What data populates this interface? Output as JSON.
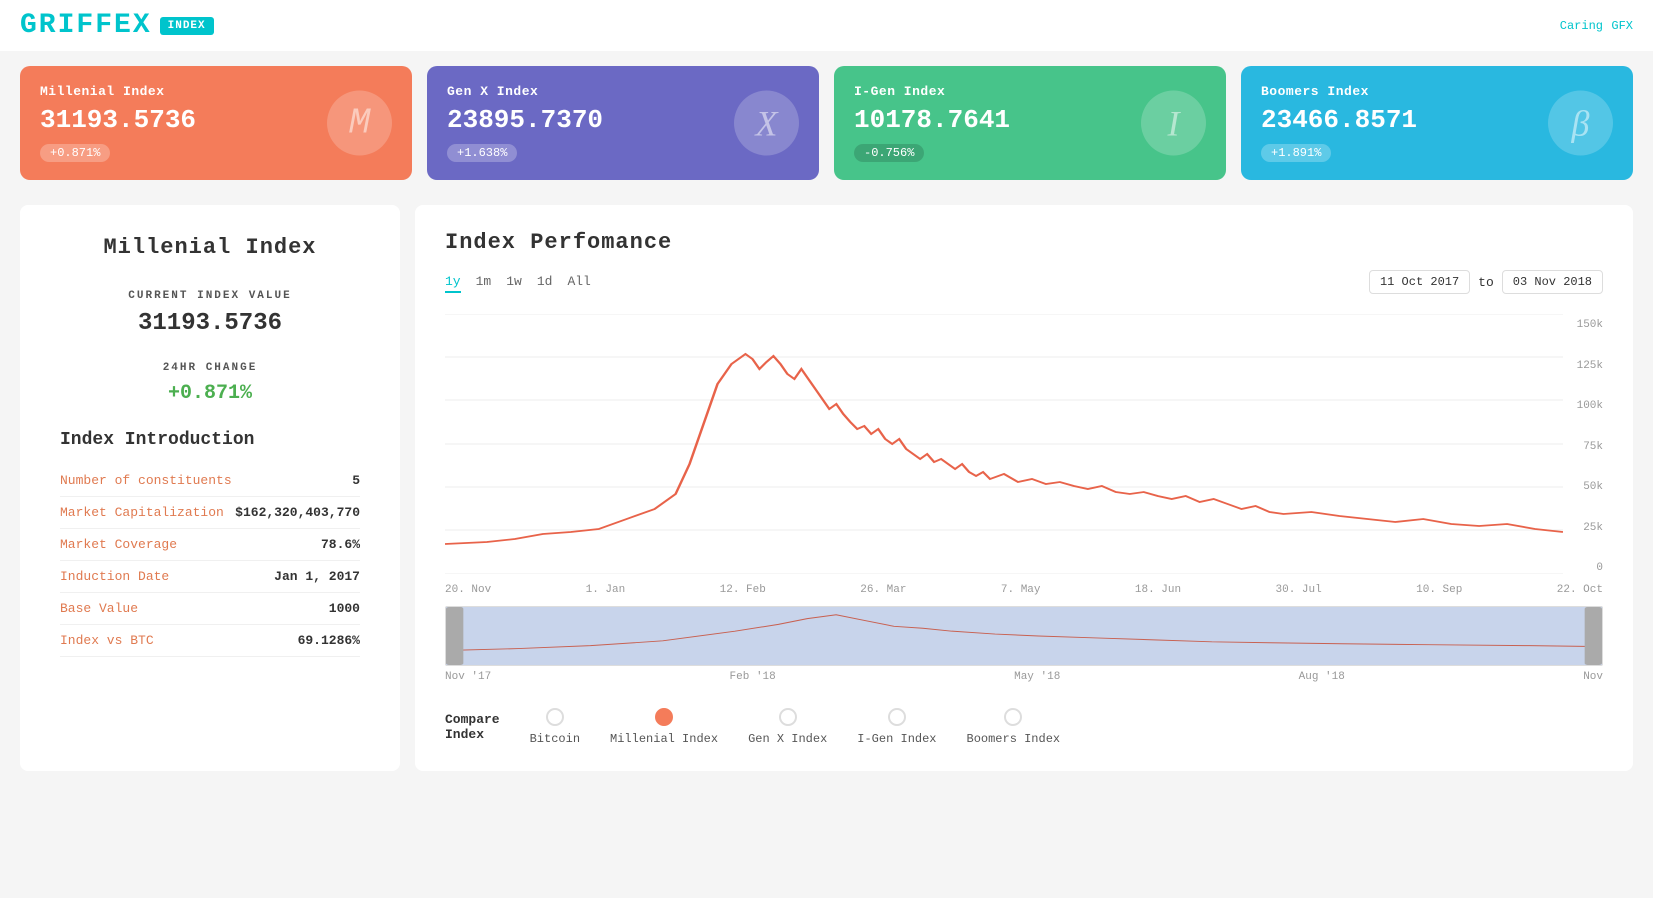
{
  "header": {
    "logo_text": "GRIFFEX",
    "logo_badge": "INDEX",
    "user_label": "Caring",
    "user_sub": "GFX"
  },
  "cards": [
    {
      "id": "millenial",
      "title": "Millenial Index",
      "value": "31193.5736",
      "change": "+0.871%",
      "change_positive": true,
      "icon": "M",
      "class": "millenial"
    },
    {
      "id": "genx",
      "title": "Gen X Index",
      "value": "23895.7370",
      "change": "+1.638%",
      "change_positive": true,
      "icon": "X",
      "class": "genx"
    },
    {
      "id": "igen",
      "title": "I-Gen Index",
      "value": "10178.7641",
      "change": "-0.756%",
      "change_positive": false,
      "icon": "I",
      "class": "igen"
    },
    {
      "id": "boomers",
      "title": "Boomers Index",
      "value": "23466.8571",
      "change": "+1.891%",
      "change_positive": true,
      "icon": "B",
      "class": "boomers"
    }
  ],
  "left_panel": {
    "title": "Millenial Index",
    "current_label": "CURRENT INDEX VALUE",
    "current_value": "31193.5736",
    "change_label": "24HR CHANGE",
    "change_value": "+0.871%",
    "intro_title": "Index Introduction",
    "rows": [
      {
        "label": "Number of constituents",
        "value": "5"
      },
      {
        "label": "Market Capitalization",
        "value": "$162,320,403,770"
      },
      {
        "label": "Market Coverage",
        "value": "78.6%"
      },
      {
        "label": "Induction Date",
        "value": "Jan 1, 2017"
      },
      {
        "label": "Base Value",
        "value": "1000"
      },
      {
        "label": "Index vs BTC",
        "value": "69.1286%"
      }
    ]
  },
  "right_panel": {
    "title": "Index Perfomance",
    "tabs": [
      "1y",
      "1m",
      "1w",
      "1d",
      "All"
    ],
    "active_tab": "1y",
    "date_from": "11 Oct 2017",
    "date_to": "03 Nov 2018",
    "date_label": "to",
    "y_labels": [
      "150k",
      "125k",
      "100k",
      "75k",
      "50k",
      "25k",
      "0"
    ],
    "x_labels": [
      "20. Nov",
      "1. Jan",
      "12. Feb",
      "26. Mar",
      "7. May",
      "18. Jun",
      "30. Jul",
      "10. Sep",
      "22. Oct"
    ],
    "mini_labels": [
      "Nov '17",
      "Feb '18",
      "May '18",
      "Aug '18",
      "Nov"
    ],
    "compare_label": "Compare\nIndex",
    "compare_options": [
      {
        "label": "Bitcoin",
        "active": false
      },
      {
        "label": "Millenial\nIndex",
        "active": true
      },
      {
        "label": "Gen X Index",
        "active": false
      },
      {
        "label": "I-Gen Index",
        "active": false
      },
      {
        "label": "Boomers Index",
        "active": false
      }
    ]
  }
}
